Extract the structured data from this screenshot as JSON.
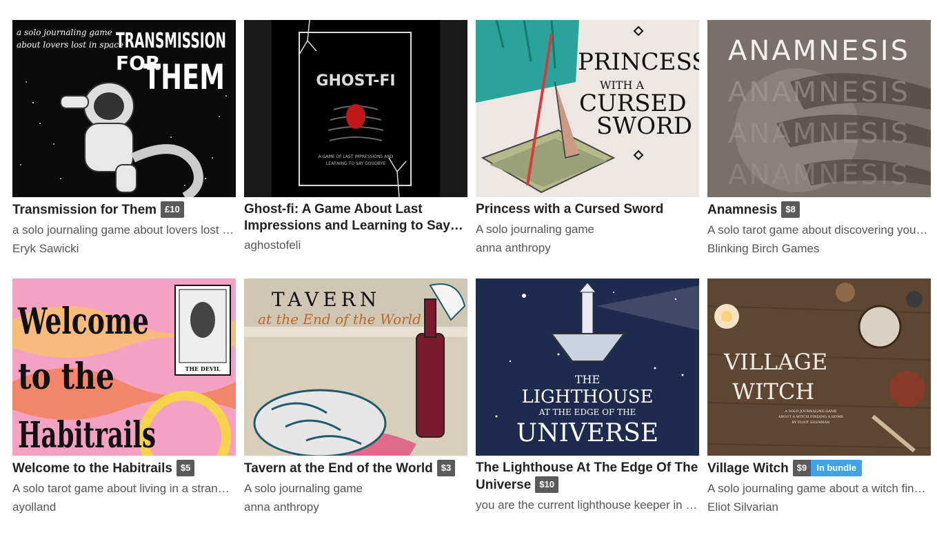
{
  "games": [
    {
      "title": "Transmission for Them",
      "price": "£10",
      "description": "a solo journaling game about lovers lost in space",
      "author": "Eryk Sawicki",
      "cover": {
        "line1": "a solo journaling game",
        "line2": "about lovers lost in space",
        "big1": "TRANSMISSION",
        "big2": "FOR",
        "big3": "THEM"
      }
    },
    {
      "title": "Ghost-fi: A Game About Last Impressions and Learning to Say Goodbye",
      "price": "",
      "description": "",
      "author": "aghostofeli",
      "cover": {
        "big1": "GHOST-FI",
        "line1": "A GAME OF LAST IMPRESSIONS AND",
        "line2": "LEARNING TO SAY GOODBYE"
      }
    },
    {
      "title": "Princess with a Cursed Sword",
      "price": "",
      "description": "A solo journaling game",
      "author": "anna anthropy",
      "cover": {
        "big1": "PRINCESS",
        "line1": "WITH A",
        "big2": "CURSED",
        "big3": "SWORD"
      }
    },
    {
      "title": "Anamnesis",
      "price": "$8",
      "description": "A solo tarot game about discovering your past",
      "author": "Blinking Birch Games",
      "cover": {
        "big1": "ANAMNESIS"
      }
    },
    {
      "title": "Welcome to the Habitrails",
      "price": "$5",
      "description": "A solo tarot game about living in a strange place",
      "author": "ayolland",
      "cover": {
        "big1": "Welcome",
        "big2": "to the",
        "big3": "Habitrails",
        "line1": "THE DEVIL"
      }
    },
    {
      "title": "Tavern at the End of the World",
      "price": "$3",
      "description": "A solo journaling game",
      "author": "anna anthropy",
      "cover": {
        "big1": "TAVERN",
        "line1": "at the End of the World"
      }
    },
    {
      "title": "The Lighthouse At The Edge Of The Universe",
      "price": "$10",
      "description": "you are the current lighthouse keeper in the universe",
      "author": "",
      "cover": {
        "line1": "THE",
        "big1": "LIGHTHOUSE",
        "line2": "AT THE EDGE OF THE",
        "big2": "UNIVERSE"
      }
    },
    {
      "title": "Village Witch",
      "price": "$9",
      "bundle": "In bundle",
      "description": "A solo journaling game about a witch finding a home",
      "author": "Eliot Silvarian",
      "cover": {
        "big1": "VILLAGE",
        "big2": "WITCH",
        "line1": "A SOLO JOURNALING GAME",
        "line2": "ABOUT A WITCH FINDING A HOME",
        "line3": "BY ELIOT SILVARIAN"
      }
    }
  ],
  "colors": {
    "price_badge": "#5a5a5a",
    "bundle_badge": "#3ea4ea",
    "title_text": "#222222",
    "meta_text": "#555555"
  }
}
